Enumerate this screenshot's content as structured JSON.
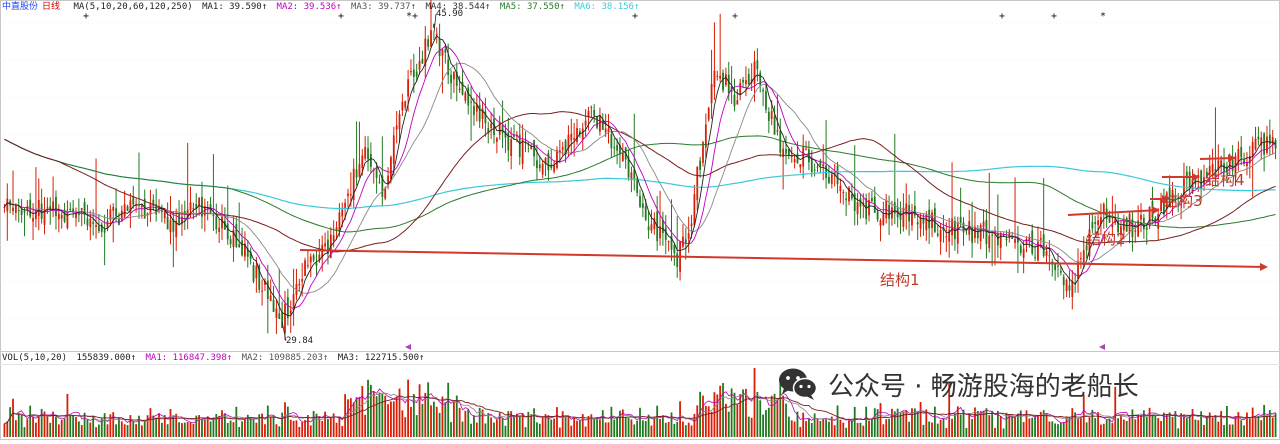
{
  "header": {
    "title": "中直股份",
    "title_suffix": "日线",
    "ma_spec": "MA(5,10,20,60,120,250)",
    "ma1": "MA1: 39.590↑",
    "ma2": "MA2: 39.536↑",
    "ma3": "MA3: 39.737↑",
    "ma4": "MA4: 38.544↑",
    "ma5": "MA5: 37.550↑",
    "ma6": "MA6: 38.156↑"
  },
  "volume_header": {
    "spec": "VOL(5,10,20)",
    "vol": "155839.000↑",
    "ma1": "MA1: 116847.398↑",
    "ma2": "MA2: 109885.203↑",
    "ma3": "MA3: 122715.500↑"
  },
  "annotations": {
    "high_label": "45.90",
    "low_label": "29.84",
    "structure1": "结构1",
    "structure2": "结构2",
    "structure3": "结构3",
    "structure4": "结构4"
  },
  "watermark": {
    "text": "公众号 · 畅游股海的老船长",
    "icon": "wechat-icon"
  },
  "colors": {
    "up": "#d81e06",
    "down": "#1f7a1f",
    "ma250": "#3cc8d8",
    "ma120": "#2a7a2a",
    "ma60": "#7a1e1e",
    "ma20": "#888888",
    "ma10": "#c000c0",
    "ma5": "#222222",
    "arrow": "#d0392b"
  },
  "chart_data": {
    "type": "candlestick",
    "title": "中直股份日线",
    "high_marker": 45.9,
    "low_marker": 29.84,
    "ylim": [
      28.5,
      47
    ],
    "anchors": [
      [
        0,
        36.2
      ],
      [
        20,
        36.0
      ],
      [
        35,
        35.3
      ],
      [
        45,
        36.3
      ],
      [
        58,
        35.4
      ],
      [
        68,
        36.5
      ],
      [
        82,
        34.2
      ],
      [
        92,
        31.2
      ],
      [
        97,
        29.84
      ],
      [
        105,
        33.0
      ],
      [
        115,
        34.4
      ],
      [
        125,
        39.5
      ],
      [
        132,
        37.1
      ],
      [
        142,
        43.5
      ],
      [
        150,
        45.9
      ],
      [
        158,
        42.8
      ],
      [
        172,
        40.5
      ],
      [
        190,
        38.3
      ],
      [
        205,
        41.6
      ],
      [
        215,
        39.2
      ],
      [
        225,
        35.6
      ],
      [
        235,
        33.2
      ],
      [
        240,
        35.9
      ],
      [
        248,
        44.0
      ],
      [
        255,
        42.3
      ],
      [
        262,
        43.8
      ],
      [
        270,
        40.0
      ],
      [
        285,
        38.5
      ],
      [
        300,
        36.2
      ],
      [
        315,
        35.8
      ],
      [
        330,
        35.1
      ],
      [
        350,
        34.6
      ],
      [
        362,
        33.9
      ],
      [
        372,
        31.6
      ],
      [
        382,
        35.9
      ],
      [
        395,
        35.1
      ],
      [
        410,
        37.0
      ],
      [
        430,
        38.9
      ],
      [
        444,
        40.1
      ]
    ]
  }
}
